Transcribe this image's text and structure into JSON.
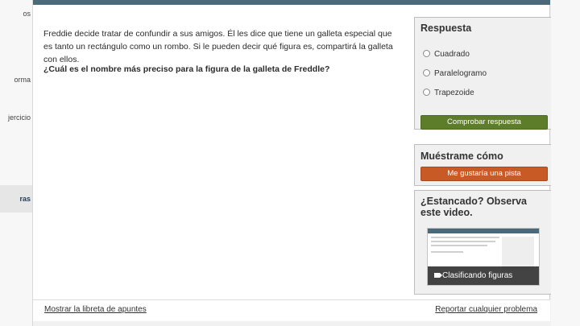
{
  "sidebar": {
    "items": [
      {
        "label": "os"
      },
      {
        "label": "orma"
      },
      {
        "label": "jercicio"
      },
      {
        "label": "ras"
      }
    ]
  },
  "question": {
    "text": "Freddie decide tratar de confundir a sus amigos. Él les dice que tiene un galleta especial que es tanto un rectángulo como un rombo. Si le pueden decir qué figura es, compartirá la galleta con ellos.",
    "prompt": "¿Cuál es el nombre más preciso para la figura de la galleta de Freddle?"
  },
  "answer_panel": {
    "title": "Respuesta",
    "options": [
      "Cuadrado",
      "Paralelogramo",
      "Trapezoide"
    ],
    "check_button": "Comprobar respuesta"
  },
  "hint_panel": {
    "title": "Muéstrame cómo",
    "hint_button": "Me gustaría una pista"
  },
  "video_panel": {
    "title": "¿Estancado? Observa este video.",
    "video_caption": "Clasificando figuras"
  },
  "footer": {
    "scratchpad_link": "Mostrar la libreta de apuntes",
    "report_link": "Reportar cualquier problema"
  },
  "colors": {
    "topbar": "#4a6a79",
    "check_button": "#5e7d2a",
    "hint_button": "#c85a25"
  }
}
